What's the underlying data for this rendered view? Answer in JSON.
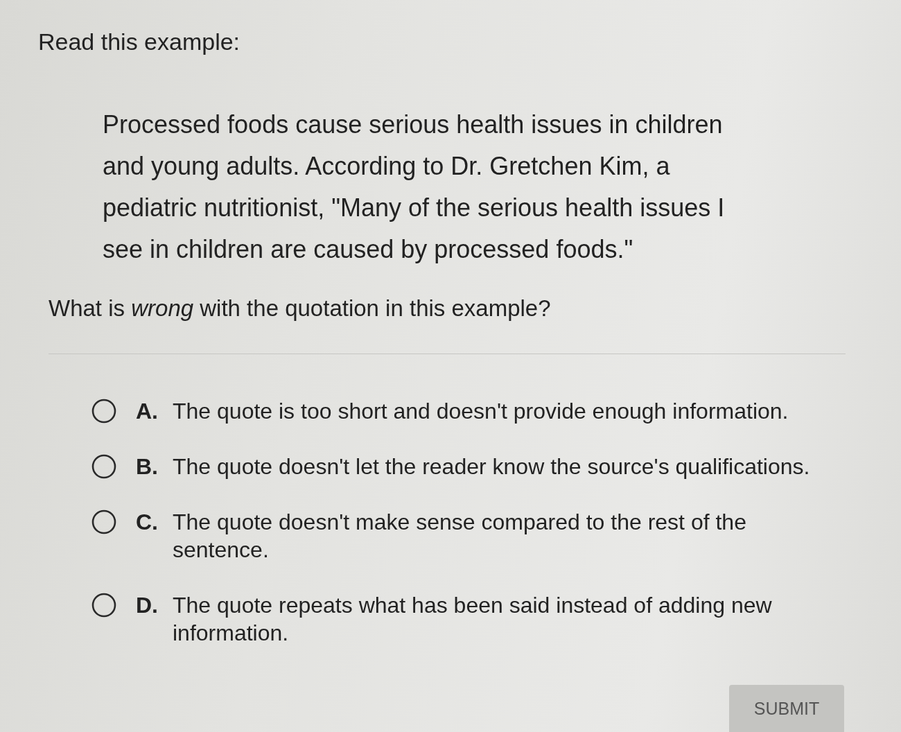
{
  "intro": "Read this example:",
  "passage": "Processed foods cause serious health issues in children and young adults. According to Dr. Gretchen Kim, a pediatric nutritionist, \"Many of the serious health issues I see in children are caused by processed foods.\"",
  "question": "What is *wrong* with the quotation in this example?",
  "options": [
    {
      "letter": "A.",
      "text": "The quote is too short and doesn't provide enough information.",
      "selected": false
    },
    {
      "letter": "B.",
      "text": "The quote doesn't let the reader know the source's qualifications.",
      "selected": false
    },
    {
      "letter": "C.",
      "text": "The quote doesn't make sense compared to the rest of the sentence.",
      "selected": false
    },
    {
      "letter": "D.",
      "text": "The quote repeats what has been said instead of adding new information.",
      "selected": false
    }
  ],
  "submit": {
    "label": "SUBMIT",
    "disabled": true
  }
}
